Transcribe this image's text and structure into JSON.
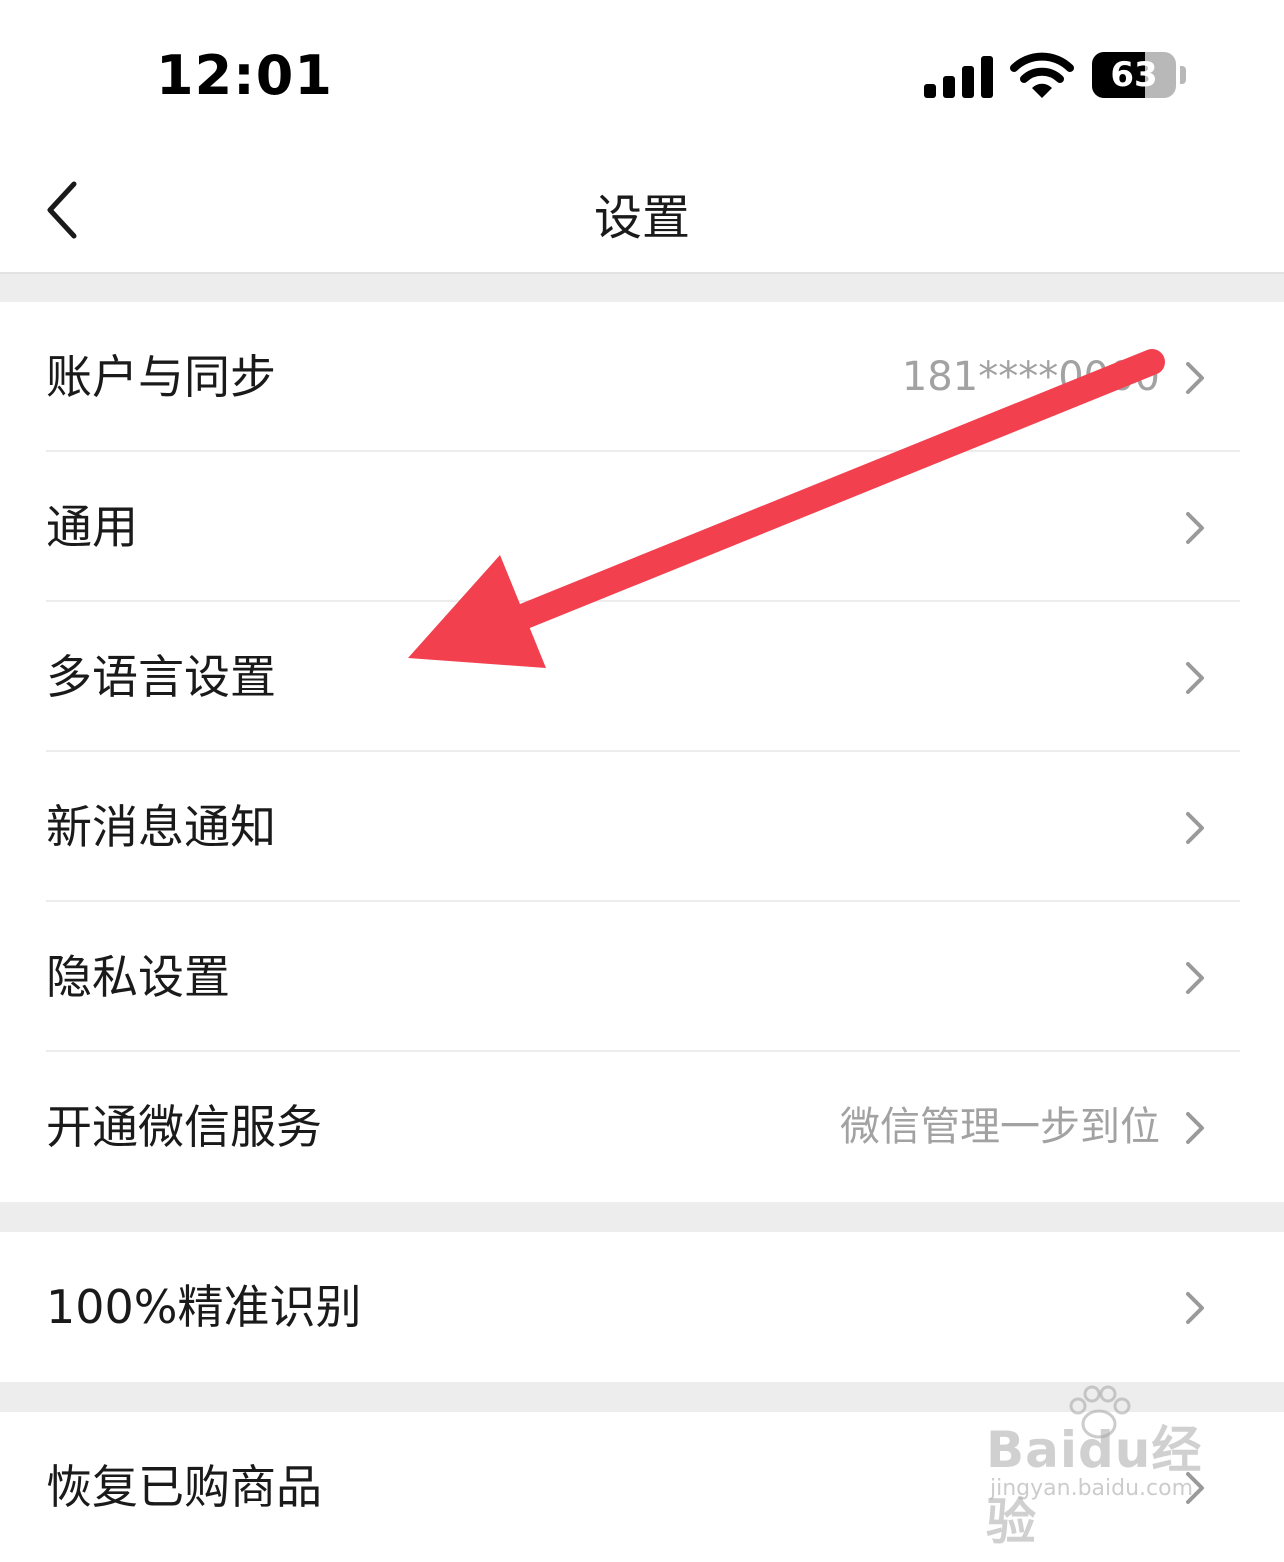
{
  "status_bar": {
    "time": "12:01",
    "battery_level": "63",
    "battery_fraction": 0.63
  },
  "nav": {
    "title": "设置",
    "back_icon": "chevron-left-icon"
  },
  "groups": [
    {
      "rows": [
        {
          "label": "账户与同步",
          "value": "181****0000"
        },
        {
          "label": "通用",
          "value": ""
        },
        {
          "label": "多语言设置",
          "value": ""
        },
        {
          "label": "新消息通知",
          "value": ""
        },
        {
          "label": "隐私设置",
          "value": ""
        },
        {
          "label": "开通微信服务",
          "value": "微信管理一步到位"
        }
      ]
    },
    {
      "rows": [
        {
          "label": "100%精准识别",
          "value": ""
        }
      ]
    },
    {
      "rows": [
        {
          "label": "恢复已购商品",
          "value": ""
        }
      ]
    }
  ],
  "annotation": {
    "arrow_color": "#f2404f"
  },
  "watermark": {
    "brand": "Baidu经验",
    "url": "jingyan.baidu.com"
  }
}
